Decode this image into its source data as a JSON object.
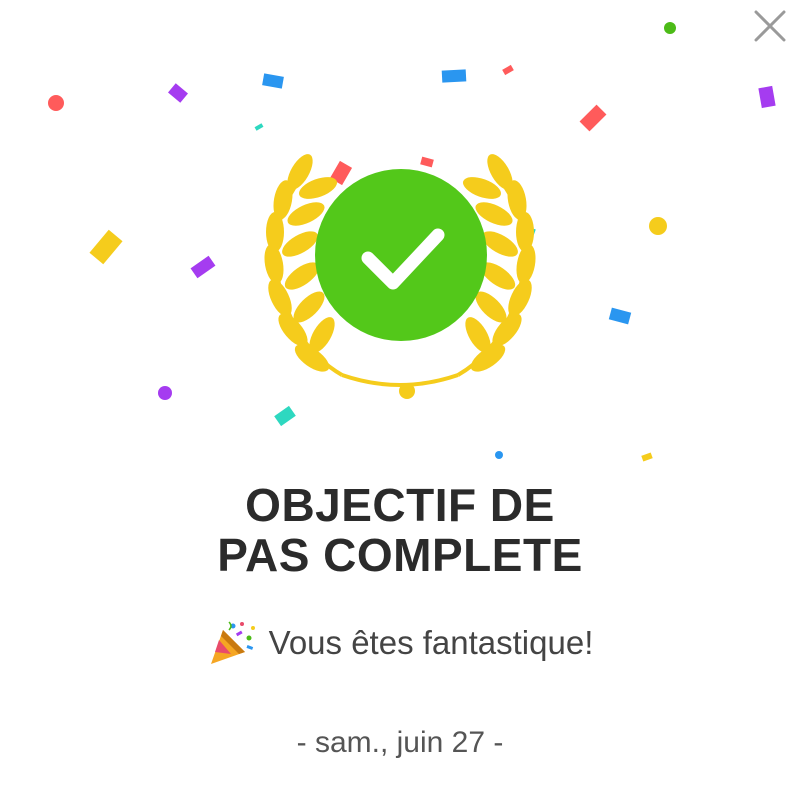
{
  "dialog": {
    "close_icon": "close-icon",
    "badge_icon": "checkmark-icon",
    "title_line1": "OBJECTIF DE",
    "title_line2": "PAS COMPLETE",
    "subtitle": "Vous êtes fantastique!",
    "subtitle_icon": "party-popper-icon",
    "date": "- sam., juin 27 -"
  },
  "colors": {
    "badge_green": "#53c81a",
    "laurel_gold": "#f5cc1c",
    "text_dark": "#2b2b2b",
    "text_muted": "#555555",
    "close_gray": "#9a9a9a",
    "confetti": [
      "#ff5b5b",
      "#a53cf0",
      "#2a96f0",
      "#f5cc1c",
      "#2ed8c0",
      "#4cbb17"
    ]
  }
}
